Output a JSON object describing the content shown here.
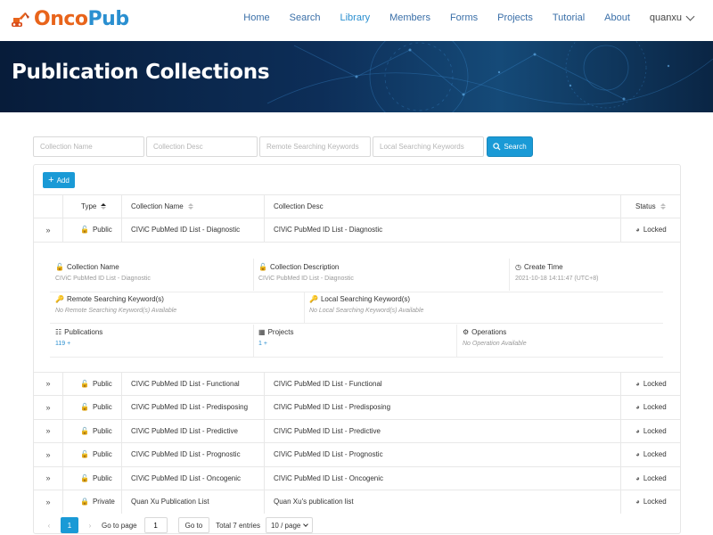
{
  "nav": {
    "logo_part1": "Onco",
    "logo_part2": "Pub",
    "links": [
      {
        "label": "Home"
      },
      {
        "label": "Search"
      },
      {
        "label": "Library"
      },
      {
        "label": "Members"
      },
      {
        "label": "Forms"
      },
      {
        "label": "Projects"
      },
      {
        "label": "Tutorial"
      },
      {
        "label": "About"
      }
    ],
    "user": "quanxu",
    "active_link": "Library"
  },
  "banner": {
    "title": "Publication Collections"
  },
  "search": {
    "placeholders": [
      "Collection Name",
      "Collection Desc",
      "Remote Searching Keywords",
      "Local Searching Keywords"
    ],
    "button_label": "Search"
  },
  "toolbar": {
    "add_label": "Add"
  },
  "table": {
    "headers": {
      "type": "Type",
      "name": "Collection Name",
      "desc": "Collection Desc",
      "status": "Status"
    },
    "rows": [
      {
        "type": "Public",
        "name": "CIViC PubMed ID List - Diagnostic",
        "desc": "CIViC PubMed ID List - Diagnostic",
        "status": "Locked",
        "expanded": true
      },
      {
        "type": "Public",
        "name": "CIViC PubMed ID List - Functional",
        "desc": "CIViC PubMed ID List - Functional",
        "status": "Locked"
      },
      {
        "type": "Public",
        "name": "CIViC PubMed ID List - Predisposing",
        "desc": "CIViC PubMed ID List - Predisposing",
        "status": "Locked"
      },
      {
        "type": "Public",
        "name": "CIViC PubMed ID List - Predictive",
        "desc": "CIViC PubMed ID List - Predictive",
        "status": "Locked"
      },
      {
        "type": "Public",
        "name": "CIViC PubMed ID List - Prognostic",
        "desc": "CIViC PubMed ID List - Prognostic",
        "status": "Locked"
      },
      {
        "type": "Public",
        "name": "CIViC PubMed ID List - Oncogenic",
        "desc": "CIViC PubMed ID List - Oncogenic",
        "status": "Locked"
      },
      {
        "type": "Private",
        "name": "Quan Xu Publication List",
        "desc": "Quan Xu's publication list",
        "status": "Locked"
      }
    ]
  },
  "detail": {
    "collection_name_label": "Collection Name",
    "collection_name_value": "CIViC PubMed ID List - Diagnostic",
    "collection_desc_label": "Collection Description",
    "collection_desc_value": "CIViC PubMed ID List - Diagnostic",
    "create_time_label": "Create Time",
    "create_time_value": "2021-10-18 14:11:47 (UTC+8)",
    "remote_kw_label": "Remote Searching Keyword(s)",
    "remote_kw_value": "No Remote Searching Keyword(s) Available",
    "local_kw_label": "Local Searching Keyword(s)",
    "local_kw_value": "No Local Searching Keyword(s) Available",
    "publications_label": "Publications",
    "publications_value": "119",
    "projects_label": "Projects",
    "projects_value": "1",
    "operations_label": "Operations",
    "operations_value": "No Operation Available"
  },
  "pagination": {
    "current_page": "1",
    "goto_label": "Go to page",
    "goto_value": "1",
    "goto_button": "Go to",
    "total": "Total 7 entries",
    "page_size": "10 / page"
  }
}
